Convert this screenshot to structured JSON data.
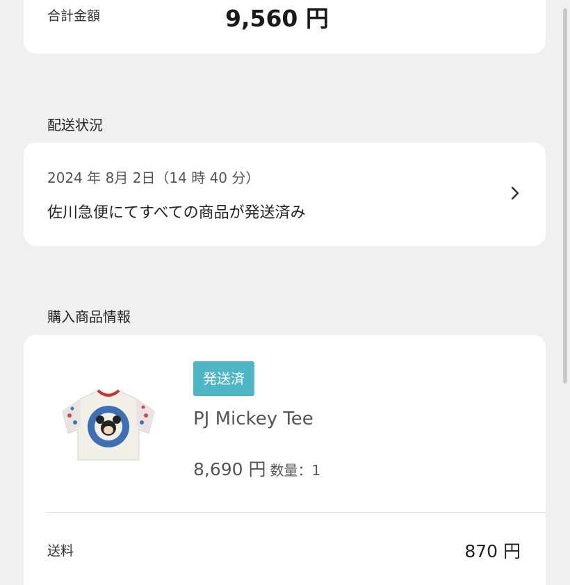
{
  "total": {
    "label": "合計金額",
    "value": "9,560 円"
  },
  "shipping": {
    "section_title": "配送状況",
    "date": "2024 年 8月 2日（14 時 40 分）",
    "status": "佐川急便にてすべての商品が発送済み"
  },
  "items": {
    "section_title": "購入商品情報",
    "product": {
      "badge": "発送済",
      "name": "PJ Mickey Tee",
      "price": "8,690 円",
      "quantity": "数量：1",
      "image_icon": "tshirt-image"
    },
    "shipping_fee_label": "送料",
    "shipping_fee_value": "870 円"
  },
  "colors": {
    "badge": "#4eb7c5",
    "background": "#eff0ef"
  }
}
